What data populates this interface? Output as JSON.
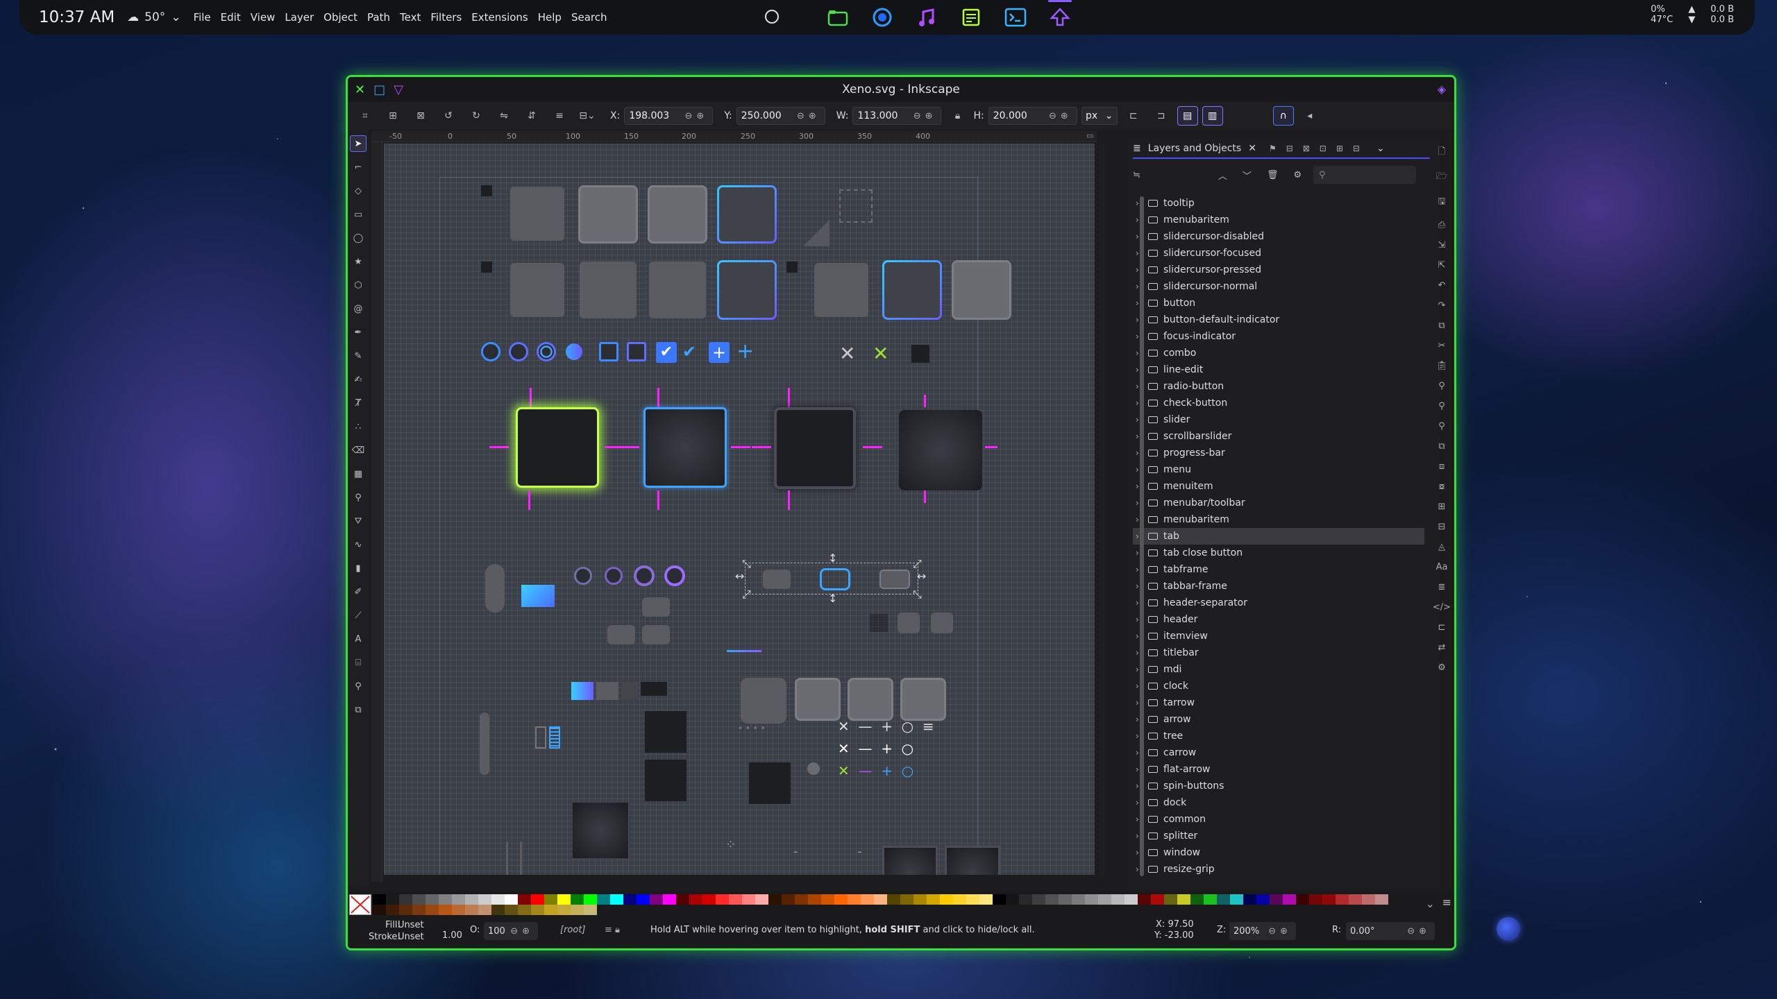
{
  "topbar": {
    "clock": "10:37 AM",
    "temperature": "50°",
    "menu": [
      "File",
      "Edit",
      "View",
      "Layer",
      "Object",
      "Path",
      "Text",
      "Filters",
      "Extensions",
      "Help",
      "Search"
    ],
    "battery": "0%",
    "cpu_temp": "47°C",
    "net_up": "0.0 B",
    "net_down": "0.0 B"
  },
  "window": {
    "title": "Xeno.svg - Inkscape",
    "accent": "#38e03a"
  },
  "toolbar": {
    "x_label": "X:",
    "x_value": "198.003",
    "y_label": "Y:",
    "y_value": "250.000",
    "w_label": "W:",
    "w_value": "113.000",
    "h_label": "H:",
    "h_value": "20.000",
    "unit": "px"
  },
  "ruler": {
    "ticks": [
      "-50",
      "0",
      "50",
      "100",
      "150",
      "200",
      "250",
      "300",
      "350",
      "400"
    ]
  },
  "dock": {
    "tab_title": "Layers and Objects",
    "search_placeholder": "",
    "layers": [
      {
        "name": "tooltip"
      },
      {
        "name": "menubaritem"
      },
      {
        "name": "slidercursor-disabled"
      },
      {
        "name": "slidercursor-focused"
      },
      {
        "name": "slidercursor-pressed"
      },
      {
        "name": "slidercursor-normal"
      },
      {
        "name": "button"
      },
      {
        "name": "button-default-indicator"
      },
      {
        "name": "focus-indicator"
      },
      {
        "name": "combo"
      },
      {
        "name": "line-edit"
      },
      {
        "name": "radio-button"
      },
      {
        "name": "check-button"
      },
      {
        "name": "slider"
      },
      {
        "name": "scrollbarslider"
      },
      {
        "name": "progress-bar"
      },
      {
        "name": "menu"
      },
      {
        "name": "menuitem"
      },
      {
        "name": "menubar/toolbar"
      },
      {
        "name": "menubaritem"
      },
      {
        "name": "tab"
      },
      {
        "name": "tab close button"
      },
      {
        "name": "tabframe"
      },
      {
        "name": "tabbar-frame"
      },
      {
        "name": "header-separator"
      },
      {
        "name": "header"
      },
      {
        "name": "itemview"
      },
      {
        "name": "titlebar"
      },
      {
        "name": "mdi"
      },
      {
        "name": "clock"
      },
      {
        "name": "tarrow"
      },
      {
        "name": "arrow"
      },
      {
        "name": "tree"
      },
      {
        "name": "carrow"
      },
      {
        "name": "flat-arrow"
      },
      {
        "name": "spin-buttons"
      },
      {
        "name": "dock"
      },
      {
        "name": "common"
      },
      {
        "name": "splitter"
      },
      {
        "name": "window"
      },
      {
        "name": "resize-grip"
      }
    ],
    "selected_layer": "tab"
  },
  "statusbar": {
    "fill_label": "Fill:",
    "fill_value": "Unset",
    "stroke_label": "Stroke:",
    "stroke_value": "Unset",
    "stroke_width": "1.00",
    "opacity_label": "O:",
    "opacity_value": "100",
    "layer": "[root]",
    "message_pre": "Hold ALT while hovering over item to highlight, ",
    "message_bold": "hold SHIFT",
    "message_post": " and click to hide/lock all.",
    "x_coord_label": "X:",
    "x_coord": "97.50",
    "y_coord_label": "Y:",
    "y_coord": "-23.00",
    "zoom_label": "Z:",
    "zoom": "200%",
    "rotation_label": "R:",
    "rotation": "0.00°"
  },
  "palette": {
    "colors": [
      "#000000",
      "#1a1a1a",
      "#333333",
      "#4d4d4d",
      "#666666",
      "#808080",
      "#999999",
      "#b3b3b3",
      "#cccccc",
      "#e6e6e6",
      "#ffffff",
      "#800000",
      "#ff0000",
      "#808000",
      "#ffff00",
      "#008000",
      "#00ff00",
      "#008080",
      "#00ffff",
      "#000080",
      "#0000ff",
      "#800080",
      "#ff00ff",
      "#550000",
      "#aa0000",
      "#d40000",
      "#ff2a2a",
      "#ff5555",
      "#ff8080",
      "#ffaaaa",
      "#2b1100",
      "#552200",
      "#803300",
      "#aa4400",
      "#d45500",
      "#ff6600",
      "#ff7f2a",
      "#ff9955",
      "#ffb380",
      "#554400",
      "#806600",
      "#aa8800",
      "#d4aa00",
      "#ffcc00",
      "#ffd42a",
      "#ffdd55",
      "#ffe680"
    ]
  }
}
